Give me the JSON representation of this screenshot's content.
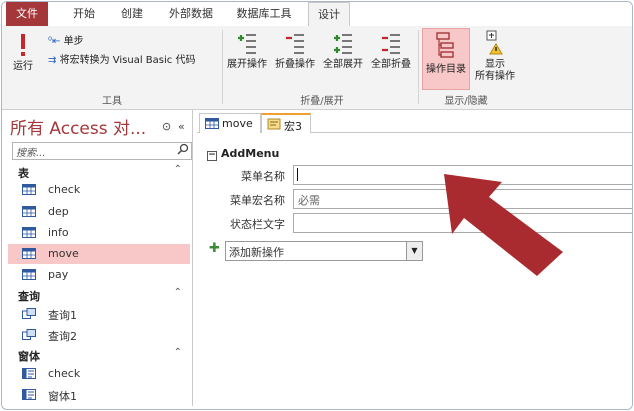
{
  "ribbon_tabs": [
    "文件",
    "开始",
    "创建",
    "外部数据",
    "数据库工具",
    "设计"
  ],
  "ribbon": {
    "run_label": "运行",
    "step_label": "单步",
    "convert_label": "将宏转换为 Visual Basic 代码",
    "tools_group": "工具",
    "expand_action": "展开操作",
    "collapse_action": "折叠操作",
    "expand_all": "全部展开",
    "collapse_all": "全部折叠",
    "fold_group": "折叠/展开",
    "action_catalog": "操作目录",
    "show_all_line1": "显示",
    "show_all_line2": "所有操作",
    "show_group": "显示/隐藏"
  },
  "nav": {
    "title": "所有 Access 对...",
    "collapse_glyph": "«",
    "menu_glyph": "⊙",
    "search_placeholder": "搜索...",
    "sections": [
      {
        "label": "表",
        "items": [
          "check",
          "dep",
          "info",
          "move",
          "pay"
        ]
      },
      {
        "label": "查询",
        "items": [
          "查询1",
          "查询2"
        ]
      },
      {
        "label": "窗体",
        "items": [
          "check",
          "窗体1"
        ]
      }
    ],
    "selected_item": "move"
  },
  "doc_tabs": [
    "move",
    "宏3"
  ],
  "macro": {
    "name": "AddMenu",
    "menu_name_label": "菜单名称",
    "menu_name_value": "",
    "menu_macro_label": "菜单宏名称",
    "menu_macro_value": "必需",
    "status_text_label": "状态栏文字",
    "status_text_value": "",
    "add_action_label": "添加新操作"
  },
  "colors": {
    "file_tab": "#a4373a",
    "selection": "#f8c7c7",
    "arrow": "#a92b2f"
  }
}
